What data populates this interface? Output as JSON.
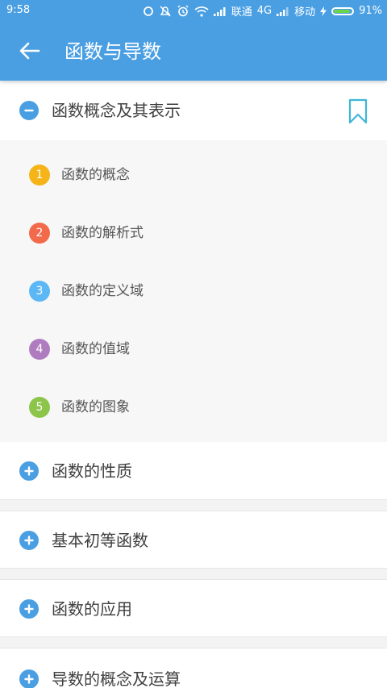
{
  "status_bar": {
    "time": "9:58",
    "carrier1": "联通",
    "network": "4G",
    "carrier2": "移动",
    "battery": "91%",
    "battery_level": 0.91
  },
  "app_bar": {
    "back_icon": "arrow-left-icon",
    "title": "函数与导数"
  },
  "colors": {
    "primary": "#4a9fe3",
    "bookmark": "#3fb6d8"
  },
  "expanded_section": {
    "label": "函数概念及其表示",
    "icon": "minus-circle-icon",
    "bookmark_icon": "bookmark-icon",
    "items": [
      {
        "num": "1",
        "label": "函数的概念",
        "color": "#f5b418"
      },
      {
        "num": "2",
        "label": "函数的解析式",
        "color": "#f26a4b"
      },
      {
        "num": "3",
        "label": "函数的定义域",
        "color": "#5cb7f5"
      },
      {
        "num": "4",
        "label": "函数的值域",
        "color": "#b07cc0"
      },
      {
        "num": "5",
        "label": "函数的图象",
        "color": "#8cc54a"
      }
    ]
  },
  "sections": [
    {
      "label": "函数的性质",
      "icon": "plus-circle-icon"
    },
    {
      "label": "基本初等函数",
      "icon": "plus-circle-icon"
    },
    {
      "label": "函数的应用",
      "icon": "plus-circle-icon"
    },
    {
      "label": "导数的概念及运算",
      "icon": "plus-circle-icon"
    }
  ]
}
